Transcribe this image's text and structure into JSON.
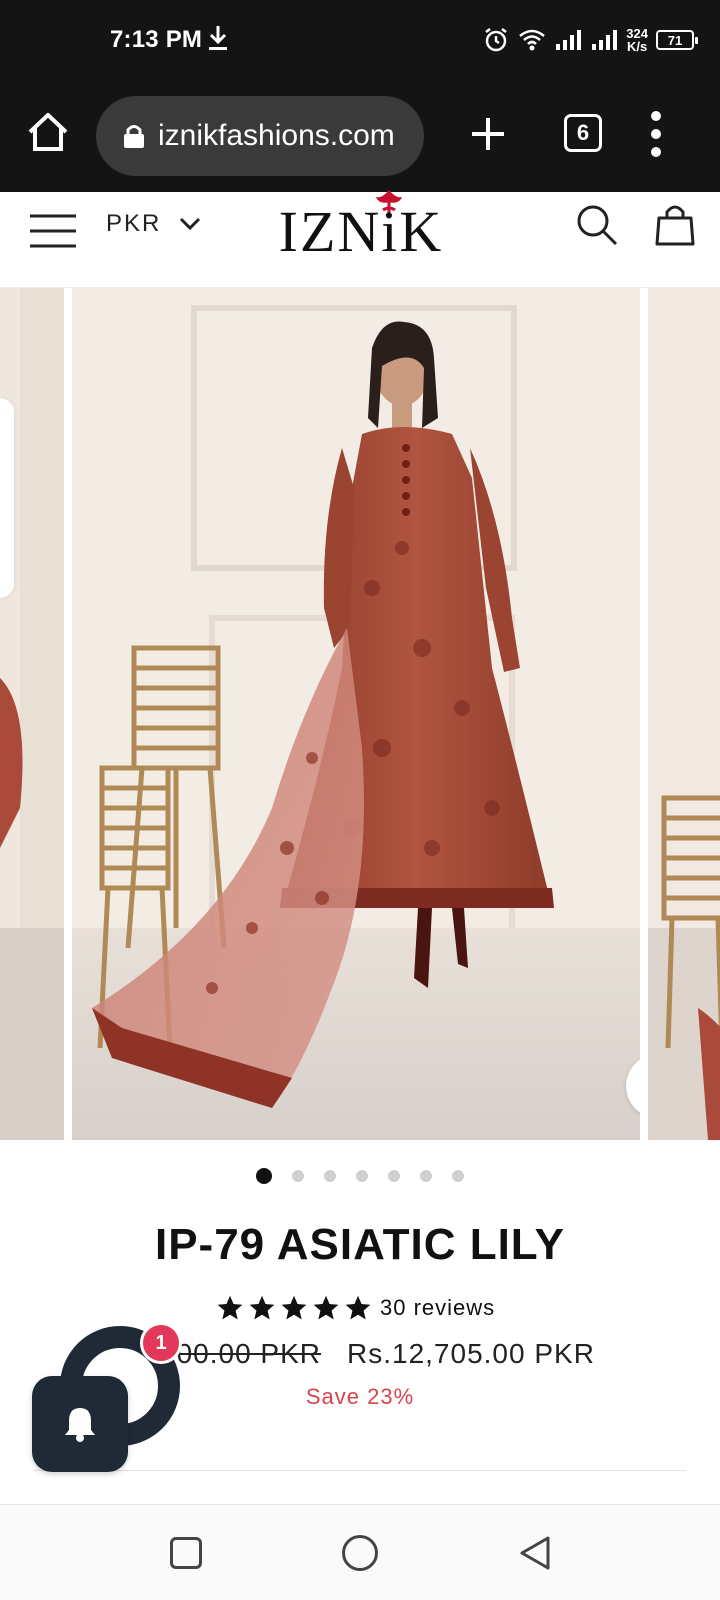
{
  "status_bar": {
    "time": "7:13 PM",
    "speed_value": "324",
    "speed_unit": "K/s",
    "battery": "71",
    "icons": [
      "download-icon",
      "alarm-icon",
      "wifi-icon",
      "signal-icon",
      "signal-icon",
      "battery-icon"
    ]
  },
  "browser": {
    "url": "iznikfashions.com",
    "tab_count": "6",
    "icons": [
      "home-icon",
      "lock-icon",
      "plus-icon",
      "tabs-icon",
      "more-icon"
    ]
  },
  "header": {
    "currency": "PKR",
    "logo": "IZNiK",
    "icons": [
      "menu-icon",
      "chevron-down-icon",
      "search-icon",
      "bag-icon"
    ]
  },
  "gallery": {
    "slide_count": 7,
    "active_slide": 0
  },
  "product": {
    "title": "IP-79 ASIATIC LILY",
    "rating_stars": 5,
    "reviews": "30 reviews",
    "old_price": "500.00 PKR",
    "new_price": "Rs.12,705.00 PKR",
    "save": "Save 23%"
  },
  "widgets": {
    "notification_badge": "1"
  },
  "colors": {
    "status_bg": "#141414",
    "url_pill": "#3a3a3a",
    "save_red": "#d9434a",
    "badge": "#e3385a",
    "widget_navy": "#1f2a36",
    "logo_red": "#c8102e"
  }
}
